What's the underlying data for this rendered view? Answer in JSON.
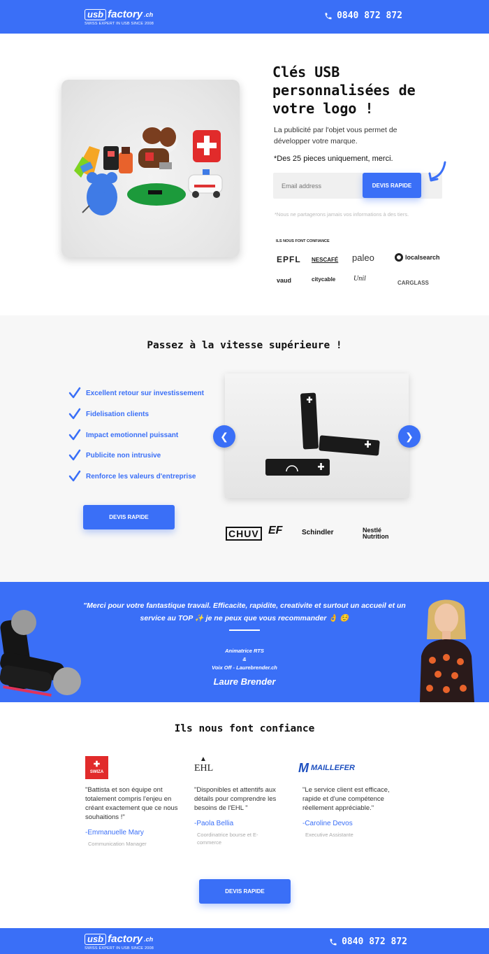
{
  "header": {
    "logo_usb": "usb",
    "logo_factory": "factory",
    "logo_ch": ".ch",
    "tagline": "SWISS EXPERT IN USB SINCE 2008",
    "phone": "0840 872 872"
  },
  "hero": {
    "title": "Clés USB personnalisées de votre logo !",
    "subtitle": "La publicité par l'objet vous permet de développer votre marque.",
    "note": "*Des 25 pieces uniquement, merci.",
    "email_placeholder": "Email address",
    "cta": "DEVIS RAPIDE",
    "privacy": "*Nous ne partagerons jamais vos informations à des tiers.",
    "trust_label": "ILS NOUS FONT CONFIANCE",
    "brands": [
      "EPFL",
      "NESCAFÉ",
      "paleo",
      "localsearch",
      "vaud",
      "citycable",
      "Unil",
      "CARGLASS"
    ]
  },
  "features": {
    "title": "Passez à la vitesse supérieure !",
    "items": [
      "Excellent retour sur investissement",
      "Fidelisation clients",
      "Impact emotionnel puissant",
      "Publicite non intrusive",
      "Renforce les valeurs d'entreprise"
    ],
    "cta": "DEVIS RAPIDE",
    "clients": [
      "CHUV",
      "EF",
      "Schindler",
      "Nestlé Nutrition"
    ]
  },
  "testimonial": {
    "quote": "\"Merci pour votre fantastique travail. Efficacite, rapidite, creativite et surtout un accueil et un service au TOP ✨ je ne peux que vous recommander 👌 ☺️",
    "role_1": "Animatrice RTS",
    "role_amp": "&",
    "role_2": "Voix Off - Laurebrender.ch",
    "name": "Laure Brender"
  },
  "trust": {
    "title": "Ils nous font confiance",
    "items": [
      {
        "logo": "SWIZA",
        "text": "\"Battista et son équipe ont totalement compris l'enjeu en créant exactement que ce nous souhaitions !\"",
        "name": "-Emmanuelle Mary",
        "title": "Communication Manager"
      },
      {
        "logo": "EHL",
        "text": "\"Disponibles et attentifs aux détails pour comprendre les besoins de l'EHL \"",
        "name": "-Paola Bellia",
        "title": "Coordinatrice bourse et E-commerce"
      },
      {
        "logo": "MAILLEFER",
        "text": "\"Le service client est efficace, rapide et d'une compétence réellement appréciable.\"",
        "name": "-Caroline Devos",
        "title": "Executive Assistante"
      }
    ],
    "cta": "DEVIS RAPIDE"
  },
  "colors": {
    "accent": "#3a6ff7",
    "section_bg": "#f7f7f7"
  }
}
